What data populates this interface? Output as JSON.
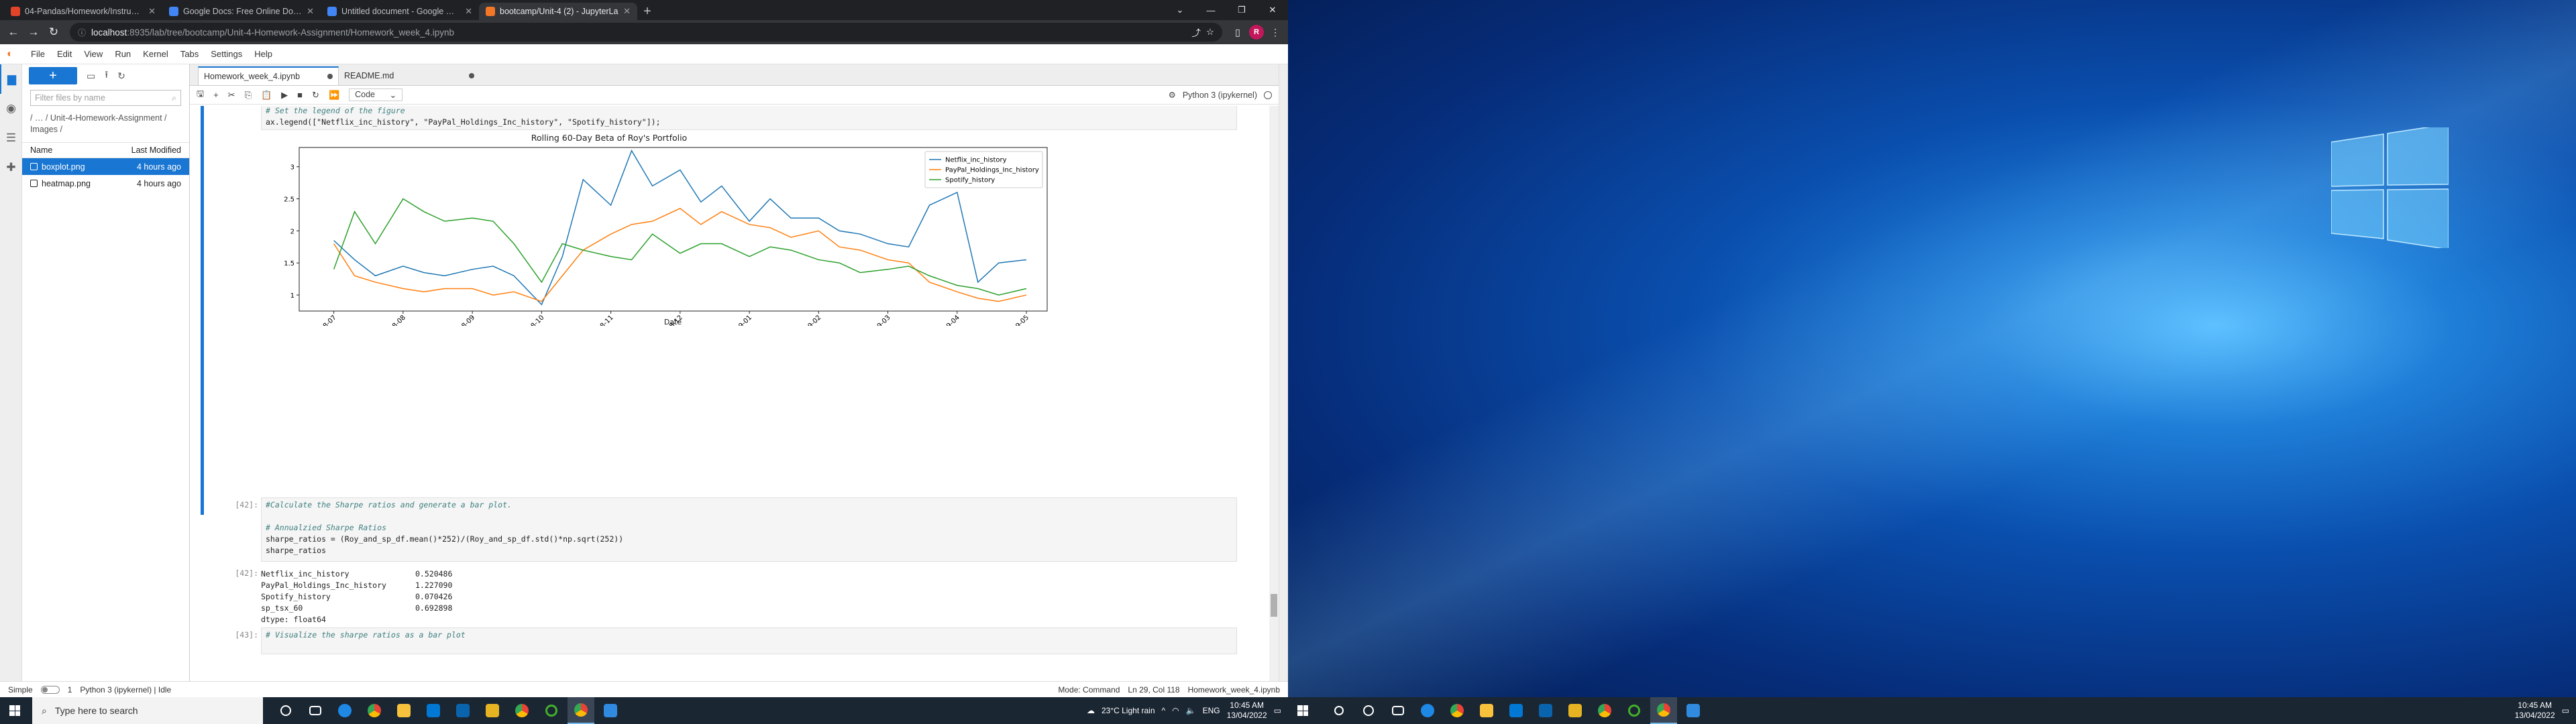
{
  "browser": {
    "tabs": [
      {
        "title": "04-Pandas/Homework/Instructio",
        "color": "#e24329"
      },
      {
        "title": "Google Docs: Free Online Docum",
        "color": "#4285f4"
      },
      {
        "title": "Untitled document - Google Doc",
        "color": "#4285f4"
      },
      {
        "title": "bootcamp/Unit-4 (2) - JupyterLa",
        "color": "#f37726"
      }
    ],
    "url_host": "localhost",
    "url_rest": ":8935/lab/tree/bootcamp/Unit-4-Homework-Assignment/Homework_week_4.ipynb",
    "profile_initial": "R"
  },
  "jupyter": {
    "menu": [
      "File",
      "Edit",
      "View",
      "Run",
      "Kernel",
      "Tabs",
      "Settings",
      "Help"
    ],
    "filter_placeholder": "Filter files by name",
    "breadcrumb": "/ … / Unit-4-Homework-Assignment / Images /",
    "col_name": "Name",
    "col_modified": "Last Modified",
    "files": [
      {
        "name": "boxplot.png",
        "modified": "4 hours ago",
        "selected": true
      },
      {
        "name": "heatmap.png",
        "modified": "4 hours ago",
        "selected": false
      }
    ],
    "tabs": [
      {
        "title": "Homework_week_4.ipynb",
        "active": true
      },
      {
        "title": "README.md",
        "active": false
      }
    ],
    "cell_type": "Code",
    "kernel": "Python 3 (ipykernel)"
  },
  "cells": {
    "legend_comment": "# Set the legend of the figure",
    "legend_code": "ax.legend([\"Netflix_inc_history\", \"PayPal_Holdings_Inc_history\", \"Spotify_history\"]);",
    "prompt_in": "[42]:",
    "in42_line1": "#Calculate the Sharpe ratios and generate a bar plot.",
    "in42_line3": "# Annualzied Sharpe Ratios",
    "in42_line4": "sharpe_ratios = (Roy_and_sp_df.mean()*252)/(Roy_and_sp_df.std()*np.sqrt(252))",
    "in42_line5": "sharpe_ratios",
    "prompt_out": "[42]:",
    "output": [
      {
        "k": "Netflix_inc_history",
        "v": "0.520486"
      },
      {
        "k": "PayPal_Holdings_Inc_history",
        "v": "1.227090"
      },
      {
        "k": "Spotify_history",
        "v": "0.070426"
      },
      {
        "k": "sp_tsx_60",
        "v": "0.692898"
      },
      {
        "k": "dtype: float64",
        "v": ""
      }
    ],
    "prompt_next": "[43]:",
    "next_comment": "# Visualize the sharpe ratios as a bar plot"
  },
  "chart_data": {
    "type": "line",
    "title": "Rolling 60-Day Beta of Roy's Portfolio",
    "xlabel": "Date",
    "ylabel": "",
    "x_ticks": [
      "2018-07",
      "2018-08",
      "2018-09",
      "2018-10",
      "2018-11",
      "2018-12",
      "2019-01",
      "2019-02",
      "2019-03",
      "2019-04",
      "2019-05"
    ],
    "y_ticks": [
      1.0,
      1.5,
      2.0,
      2.5,
      3.0
    ],
    "ylim": [
      0.75,
      3.3
    ],
    "legend_position": "top-right",
    "x": [
      0,
      0.3,
      0.6,
      1,
      1.3,
      1.6,
      2,
      2.3,
      2.6,
      3,
      3.3,
      3.6,
      4,
      4.3,
      4.6,
      5,
      5.3,
      5.6,
      6,
      6.3,
      6.6,
      7,
      7.3,
      7.6,
      8,
      8.3,
      8.6,
      9,
      9.3,
      9.6,
      10
    ],
    "series": [
      {
        "name": "Netflix_inc_history",
        "color": "#1f77b4",
        "values": [
          1.85,
          1.55,
          1.3,
          1.45,
          1.35,
          1.3,
          1.4,
          1.45,
          1.3,
          0.85,
          1.6,
          2.8,
          2.4,
          3.25,
          2.7,
          2.95,
          2.45,
          2.7,
          2.15,
          2.5,
          2.2,
          2.2,
          2.0,
          1.95,
          1.8,
          1.75,
          2.4,
          2.6,
          1.2,
          1.5,
          1.55
        ]
      },
      {
        "name": "PayPal_Holdings_Inc_history",
        "color": "#ff7f0e",
        "values": [
          1.8,
          1.3,
          1.2,
          1.1,
          1.05,
          1.1,
          1.1,
          1.0,
          1.05,
          0.9,
          1.3,
          1.7,
          1.95,
          2.1,
          2.15,
          2.35,
          2.1,
          2.3,
          2.1,
          2.05,
          1.9,
          2.0,
          1.75,
          1.7,
          1.55,
          1.5,
          1.2,
          1.05,
          0.95,
          0.9,
          1.0
        ]
      },
      {
        "name": "Spotify_history",
        "color": "#2ca02c",
        "values": [
          1.4,
          2.3,
          1.8,
          2.5,
          2.3,
          2.15,
          2.2,
          2.15,
          1.8,
          1.2,
          1.8,
          1.7,
          1.6,
          1.55,
          1.95,
          1.65,
          1.8,
          1.8,
          1.6,
          1.75,
          1.7,
          1.55,
          1.5,
          1.35,
          1.4,
          1.45,
          1.3,
          1.15,
          1.1,
          1.0,
          1.1
        ]
      }
    ]
  },
  "statusbar": {
    "mode_label": "Simple",
    "counts": "1",
    "kernel_idle": "Python 3 (ipykernel) | Idle",
    "mode": "Mode: Command",
    "position": "Ln 29, Col 118",
    "file": "Homework_week_4.ipynb"
  },
  "taskbar": {
    "search_placeholder": "Type here to search",
    "weather": "23°C  Light rain",
    "lang": "ENG",
    "time": "10:45 AM",
    "date": "13/04/2022"
  }
}
